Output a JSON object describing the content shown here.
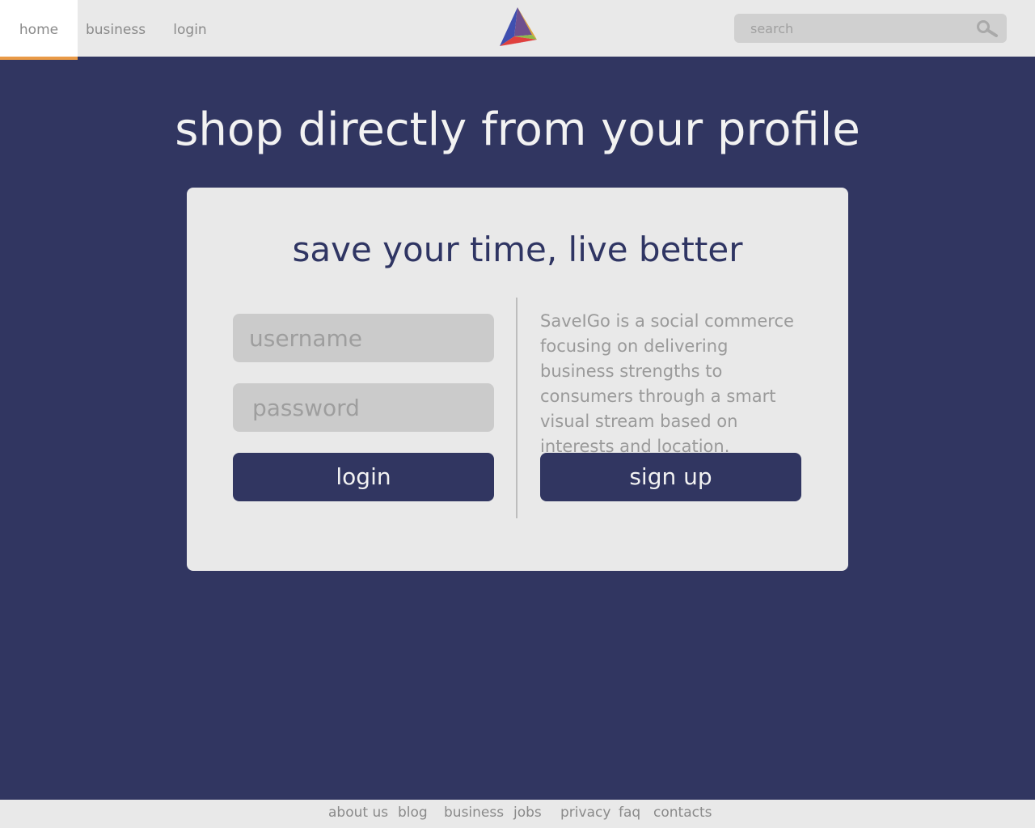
{
  "nav": {
    "items": [
      {
        "label": "home",
        "active": true
      },
      {
        "label": "business",
        "active": false
      },
      {
        "label": "login",
        "active": false
      }
    ]
  },
  "search": {
    "placeholder": "search",
    "icon": "search-icon"
  },
  "hero": {
    "title": "shop directly from your profile"
  },
  "card": {
    "title": "save your time, live better",
    "username_placeholder": "username",
    "password_placeholder": "password",
    "login_label": "login",
    "signup_label": "sign up",
    "description": "SaveIGo is a social commerce focusing on delivering business strengths to consumers through a smart visual stream based on interests and location."
  },
  "footer": {
    "links": [
      "about us",
      "blog",
      "business",
      "jobs",
      "privacy",
      "faq",
      "contacts"
    ]
  },
  "colors": {
    "background": "#313661",
    "accent": "#e99a47",
    "panel": "#e9e9e9",
    "field": "#cbcbcb"
  }
}
